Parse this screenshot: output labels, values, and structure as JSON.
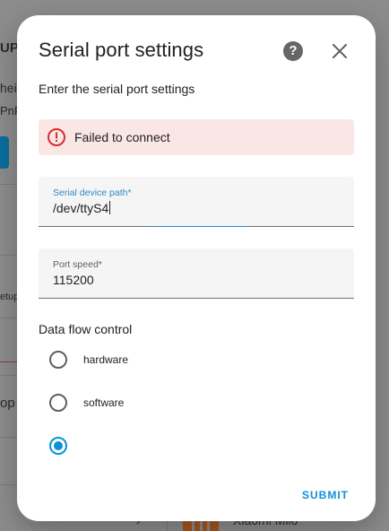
{
  "background": {
    "fragments": [
      "UP",
      "hei",
      "PnP",
      "etup",
      "op",
      "Xiaomi Miio"
    ]
  },
  "dialog": {
    "title": "Serial port settings",
    "help_icon": "help-circle-icon",
    "close_icon": "close-icon",
    "subtitle": "Enter the serial port settings",
    "alert": {
      "icon": "alert-circle-icon",
      "text": "Failed to connect",
      "color": "#fae6e5",
      "icon_color": "#d32f2f"
    },
    "fields": {
      "device_path": {
        "label": "Serial device path*",
        "value": "/dev/ttyS4"
      },
      "port_speed": {
        "label": "Port speed*",
        "value": "115200"
      }
    },
    "flow_control": {
      "title": "Data flow control",
      "options": [
        {
          "label": "hardware",
          "checked": false
        },
        {
          "label": "software",
          "checked": false
        },
        {
          "label": "",
          "checked": true
        }
      ]
    },
    "submit_label": "SUBMIT",
    "accent_color": "#0a91d8"
  }
}
